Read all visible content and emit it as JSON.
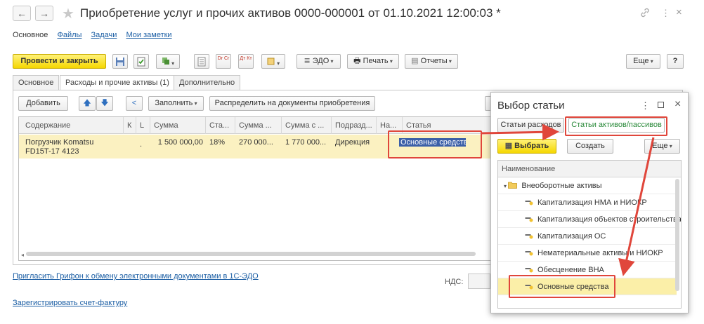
{
  "window": {
    "title": "Приобретение услуг и прочих активов 0000-000001 от 01.10.2021 12:00:03 *",
    "back_glyph": "←",
    "forward_glyph": "→",
    "star_glyph": "★",
    "link_glyph": "🔗",
    "more_glyph": "⋮",
    "close_glyph": "×"
  },
  "nav": {
    "items": [
      "Основное",
      "Файлы",
      "Задачи",
      "Мои заметки"
    ]
  },
  "toolbar": {
    "post_close": "Провести и закрыть",
    "icons": [
      "save-icon",
      "post-icon",
      "create-based-icon",
      "list-icon",
      "dt-kt-icon",
      "dt-kt-movements-icon",
      "attach-icon"
    ],
    "dtkt_label": "Dr Cr",
    "dtkt2_label": "Дт Кт",
    "edo": "ЭДО",
    "print": "Печать",
    "reports": "Отчеты",
    "more": "Еще",
    "help": "?"
  },
  "tabs": [
    "Основное",
    "Расходы и прочие активы (1)",
    "Дополнительно"
  ],
  "table_toolbar": {
    "add": "Добавить",
    "fill": "Заполнить",
    "distribute": "Распределить на документы приобретения"
  },
  "table": {
    "columns": [
      "Содержание",
      "К",
      "L",
      "Сумма",
      "Ста...",
      "Сумма ...",
      "Сумма с ...",
      "Подразд...",
      "На...",
      "Статья"
    ],
    "rows": [
      {
        "content_line1": "Погрузчик Komatsu",
        "content_line2": "FD15T-17 4123",
        "dot": ".",
        "sum": "1 500 000,00",
        "rate": "18%",
        "vat": "270 000...",
        "total": "1 770 000...",
        "department": "Дирекция",
        "article": "Основные средства"
      }
    ]
  },
  "footer": {
    "invite_link": "Пригласить Грифон к обмену электронными документами в 1С-ЭДО",
    "invoice_link": "Зарегистрировать счет-фактуру",
    "vat_label": "НДС:"
  },
  "popup": {
    "title": "Выбор статьи",
    "tab_expenses": "Статьи расходов",
    "tab_assets": "Статьи активов/пассивов",
    "select": "Выбрать",
    "create": "Создать",
    "more": "Еще",
    "list_header": "Наименование",
    "group": "Внеоборотные активы",
    "items": [
      "Капитализация НМА и НИОКР",
      "Капитализация объектов строительства",
      "Капитализация ОС",
      "Нематериальные активы и НИОКР",
      "Обесценение ВНА",
      "Основные средства"
    ],
    "selected_index": 5
  },
  "colors": {
    "accent_yellow": "#f5d700",
    "highlight_red": "#e0463b",
    "selection_blue": "#3b5fa8",
    "row_yellow": "#fbf1c1",
    "link_blue": "#1b5ea4"
  }
}
